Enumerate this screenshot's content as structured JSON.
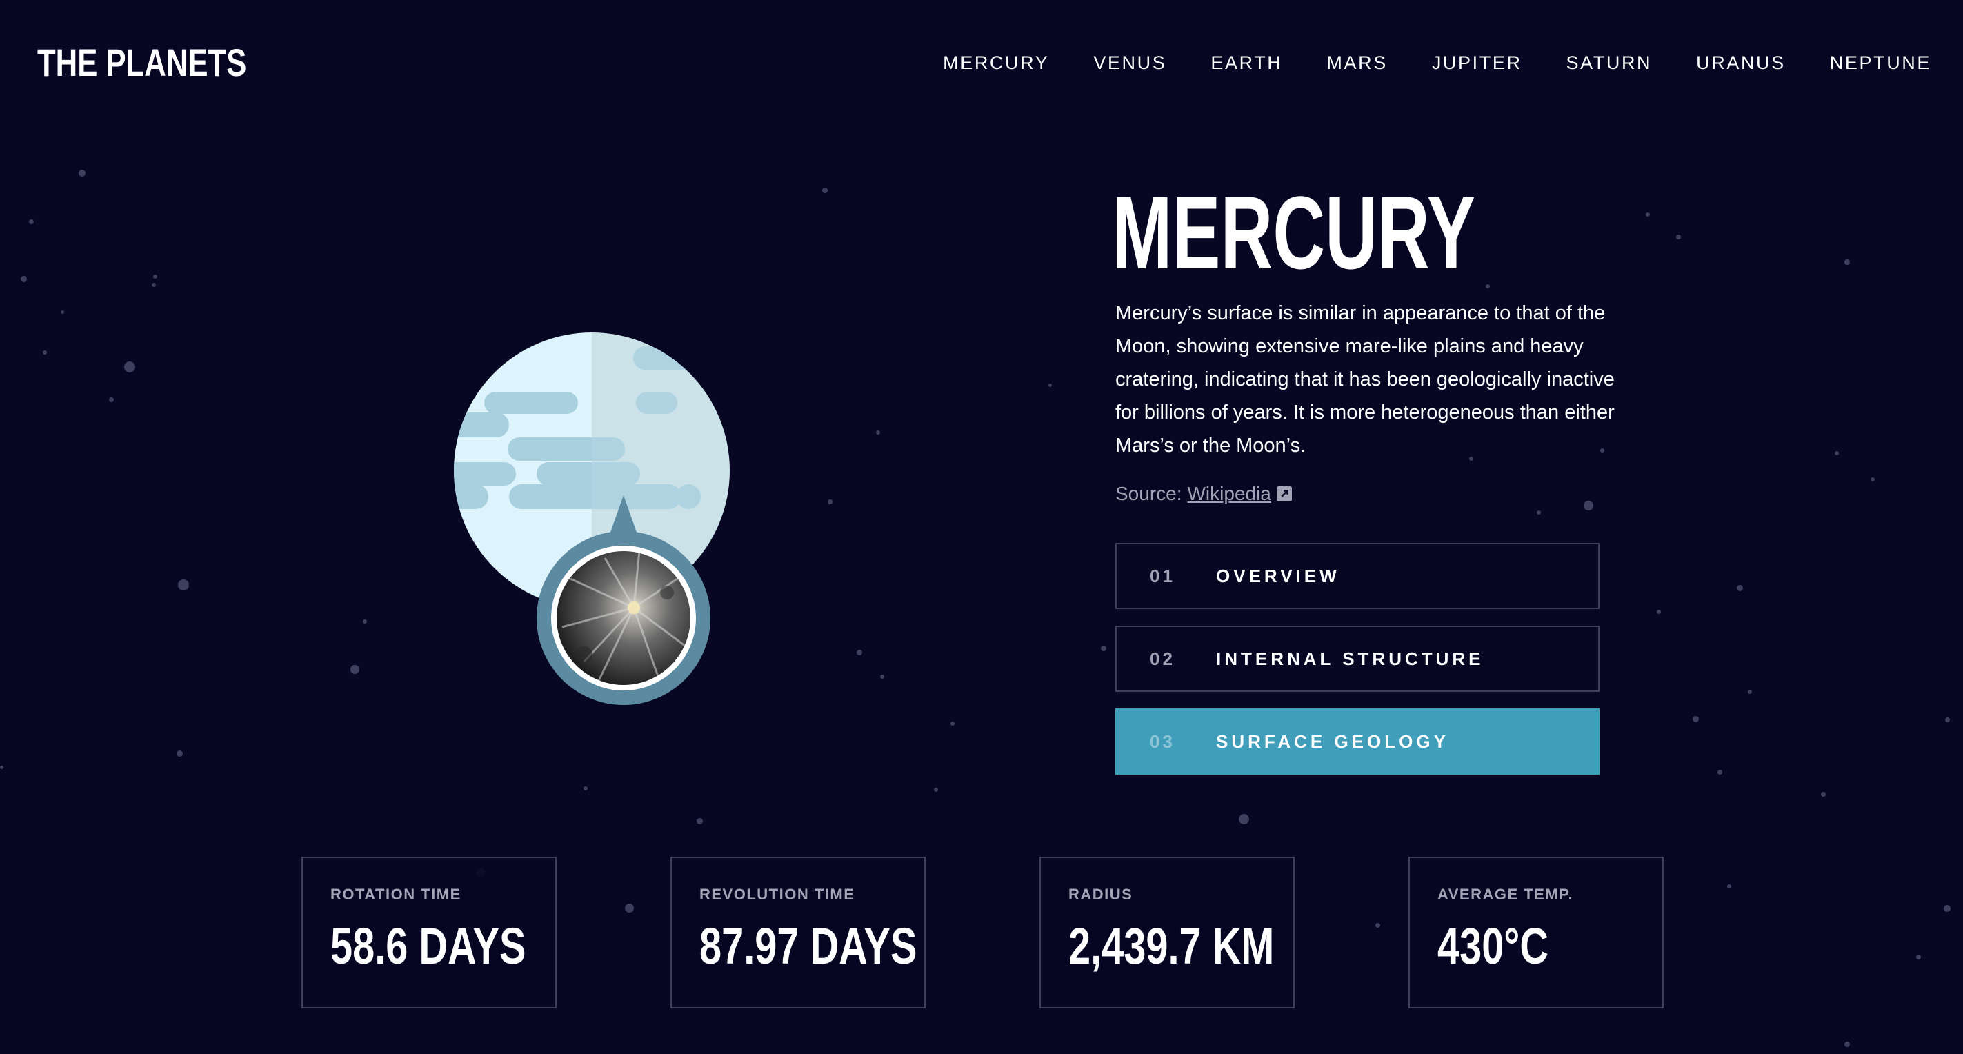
{
  "app": {
    "logo": "THE PLANETS"
  },
  "nav": {
    "items": [
      {
        "label": "MERCURY"
      },
      {
        "label": "VENUS"
      },
      {
        "label": "EARTH"
      },
      {
        "label": "MARS"
      },
      {
        "label": "JUPITER"
      },
      {
        "label": "SATURN"
      },
      {
        "label": "URANUS"
      },
      {
        "label": "NEPTUNE"
      }
    ]
  },
  "planet": {
    "name": "MERCURY",
    "description": "Mercury’s surface is similar in appearance to that of the Moon, showing extensive mare-like plains and heavy cratering, indicating that it has been geologically inactive for billions of years. It is more heterogeneous than either Mars’s or the Moon’s.",
    "source_prefix": "Source:",
    "source_link": "Wikipedia",
    "illustration_icon": "mercury-planet-icon",
    "geology_image_icon": "surface-geology-photo"
  },
  "tabs": [
    {
      "num": "01",
      "label": "OVERVIEW",
      "active": false
    },
    {
      "num": "02",
      "label": "INTERNAL STRUCTURE",
      "active": false
    },
    {
      "num": "03",
      "label": "SURFACE GEOLOGY",
      "active": true
    }
  ],
  "stats": [
    {
      "label": "ROTATION TIME",
      "value": "58.6 DAYS"
    },
    {
      "label": "REVOLUTION TIME",
      "value": "87.97 DAYS"
    },
    {
      "label": "RADIUS",
      "value": "2,439.7 KM"
    },
    {
      "label": "AVERAGE TEMP.",
      "value": "430°C"
    }
  ],
  "colors": {
    "background": "#070724",
    "accent": "#419ebb",
    "border": "#3d3f5b",
    "muted_text": "#a3a3b5",
    "planet_light": "#def4fc",
    "planet_shade": "#c8e0e8",
    "planet_band": "#a9d0de"
  }
}
